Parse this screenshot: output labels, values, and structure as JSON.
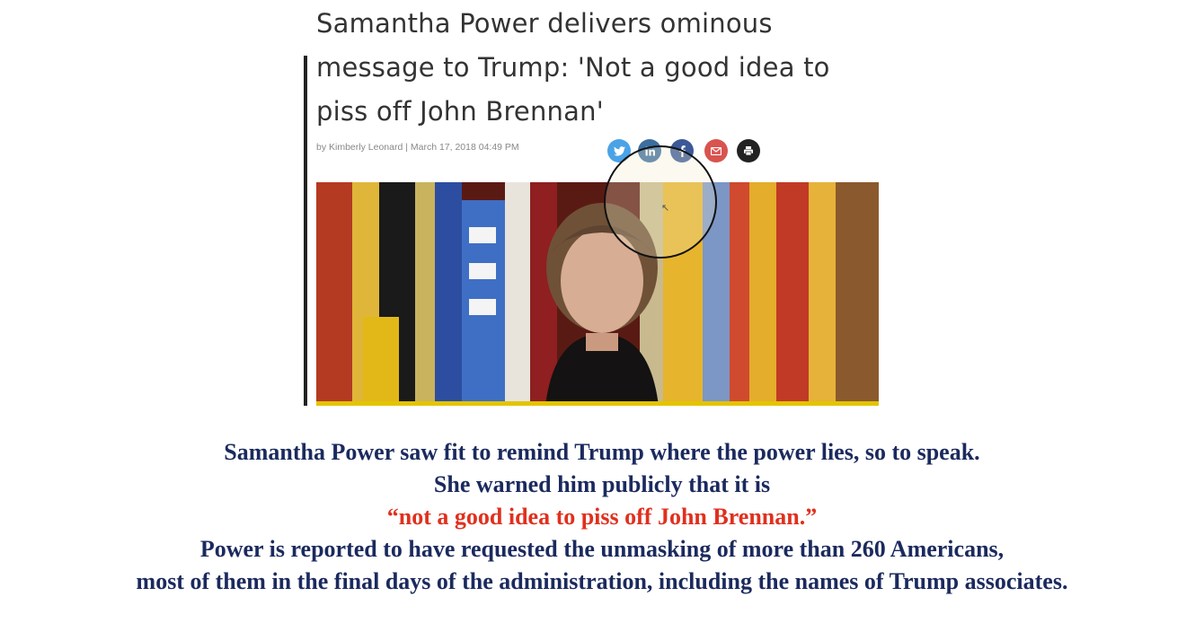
{
  "article": {
    "headline": "Samantha Power delivers ominous message to Trump: 'Not a good idea to piss off John Brennan'",
    "byline": "by Kimberly Leonard | March 17, 2018 04:49 PM",
    "share_icons": [
      "twitter-icon",
      "linkedin-icon",
      "facebook-icon",
      "email-icon",
      "print-icon"
    ]
  },
  "caption": {
    "line1": "Samantha Power saw fit to remind Trump where the power lies, so to speak.",
    "line2": "She warned him publicly that it is",
    "line3": "“not a good idea to piss off John Brennan.”",
    "line4": "Power is reported to have requested the unmasking of more than 260 Americans,",
    "line5": "most of them in the final days of the administration, including the names of Trump associates."
  },
  "colors": {
    "caption_text": "#1b2a5e",
    "quote_text": "#e0301e",
    "headline_text": "#333333"
  }
}
